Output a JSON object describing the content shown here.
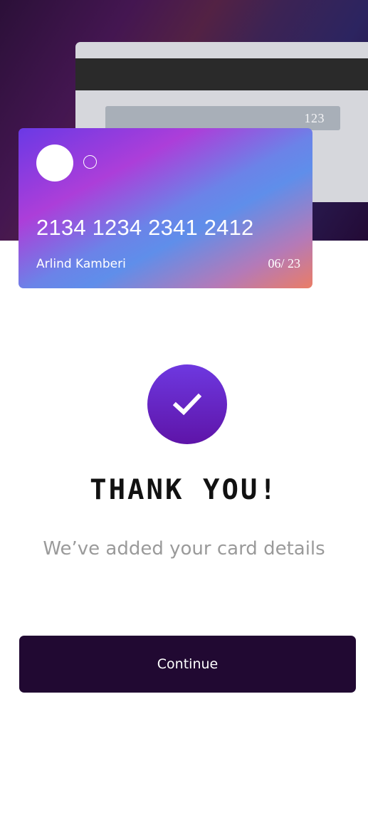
{
  "card_back": {
    "cvv": "123"
  },
  "card_front": {
    "number": "2134 1234 2341 2412",
    "holder": "Arlind Kamberi",
    "expiry": "06/ 23"
  },
  "success": {
    "icon": "checkmark-icon",
    "title": "THANK YOU!",
    "message": "We’ve added your card details"
  },
  "actions": {
    "continue_label": "Continue"
  },
  "colors": {
    "primary_dark": "#210932",
    "success_purple": "#6e38e0",
    "subtitle_gray": "#9a9a9a"
  }
}
